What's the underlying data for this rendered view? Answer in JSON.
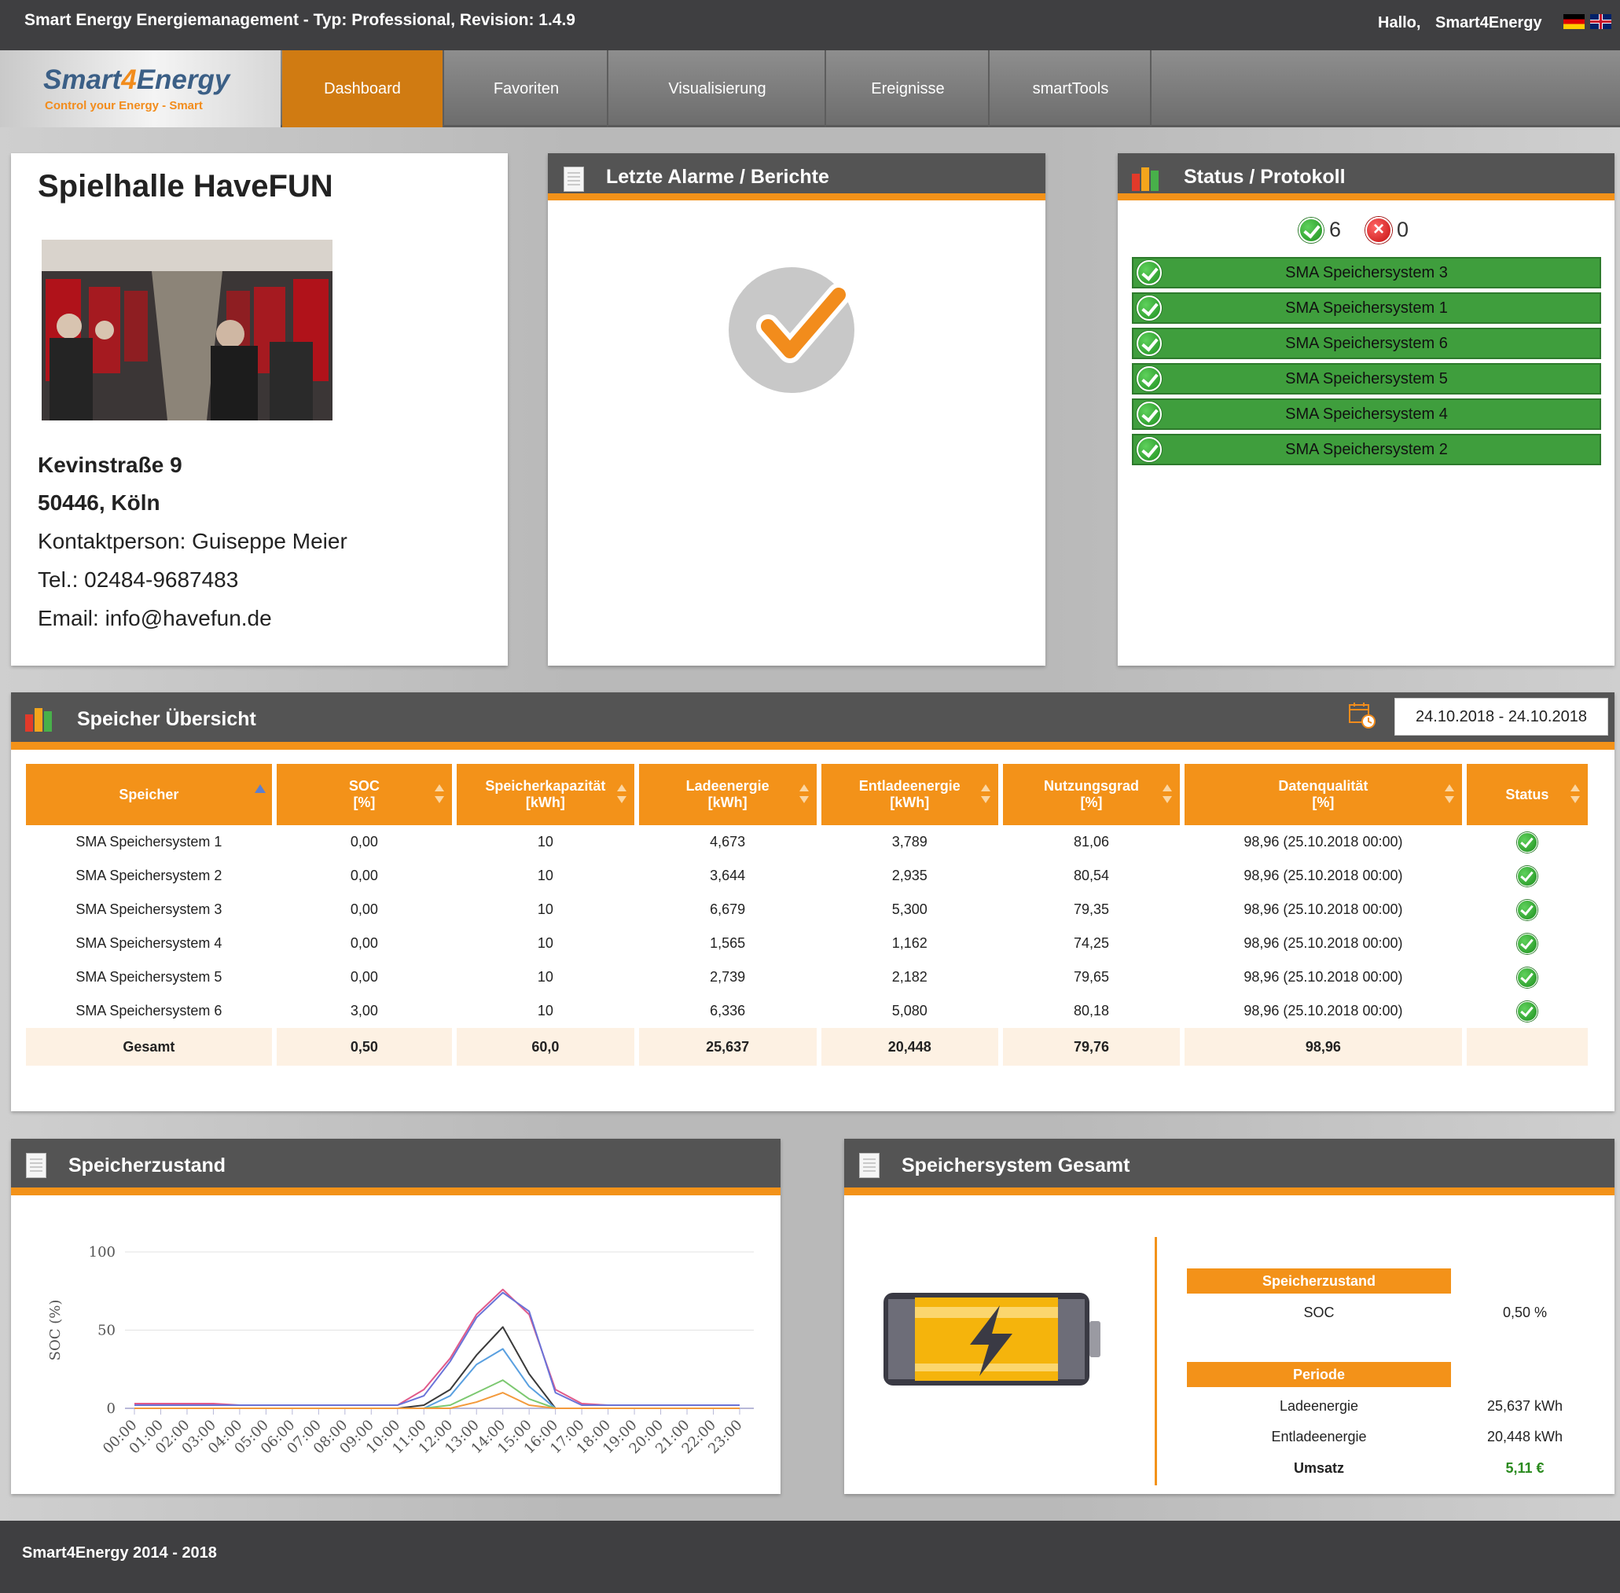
{
  "topbar": {
    "title": "Smart Energy Energiemanagement - Typ: Professional, Revision: 1.4.9",
    "greeting": "Hallo,",
    "user": "Smart4Energy",
    "flags": [
      "de-flag-icon",
      "uk-flag-icon"
    ]
  },
  "logo": {
    "brand_a": "Smart",
    "brand_num": "4",
    "brand_b": "Energy",
    "tagline": "Control your Energy - Smart"
  },
  "nav": {
    "items": [
      {
        "label": "Dashboard",
        "active": true
      },
      {
        "label": "Favoriten",
        "active": false
      },
      {
        "label": "Visualisierung",
        "active": false
      },
      {
        "label": "Ereignisse",
        "active": false
      },
      {
        "label": "smartTools",
        "active": false
      }
    ]
  },
  "site": {
    "name": "Spielhalle HaveFUN",
    "street": "Kevinstraße 9",
    "city": "50446, Köln",
    "contact": "Kontaktperson: Guiseppe Meier",
    "phone": "Tel.: 02484-9687483",
    "email": "Email: info@havefun.de"
  },
  "alarms": {
    "title": "Letzte Alarme / Berichte",
    "icon": "check-badge-icon"
  },
  "status": {
    "title": "Status / Protokoll",
    "ok_count": "6",
    "error_count": "0",
    "rows": [
      "SMA Speichersystem 3",
      "SMA Speichersystem 1",
      "SMA Speichersystem 6",
      "SMA Speichersystem 5",
      "SMA Speichersystem 4",
      "SMA Speichersystem 2"
    ]
  },
  "overview": {
    "title": "Speicher Übersicht",
    "date_range": "24.10.2018 - 24.10.2018",
    "columns": [
      {
        "line1": "Speicher",
        "line2": ""
      },
      {
        "line1": "SOC",
        "line2": "[%]"
      },
      {
        "line1": "Speicherkapazität",
        "line2": "[kWh]"
      },
      {
        "line1": "Ladeenergie",
        "line2": "[kWh]"
      },
      {
        "line1": "Entladeenergie",
        "line2": "[kWh]"
      },
      {
        "line1": "Nutzungsgrad",
        "line2": "[%]"
      },
      {
        "line1": "Datenqualität",
        "line2": "[%]"
      },
      {
        "line1": "Status",
        "line2": ""
      }
    ],
    "rows": [
      [
        "SMA Speichersystem 1",
        "0,00",
        "10",
        "4,673",
        "3,789",
        "81,06",
        "98,96 (25.10.2018 00:00)"
      ],
      [
        "SMA Speichersystem 2",
        "0,00",
        "10",
        "3,644",
        "2,935",
        "80,54",
        "98,96 (25.10.2018 00:00)"
      ],
      [
        "SMA Speichersystem 3",
        "0,00",
        "10",
        "6,679",
        "5,300",
        "79,35",
        "98,96 (25.10.2018 00:00)"
      ],
      [
        "SMA Speichersystem 4",
        "0,00",
        "10",
        "1,565",
        "1,162",
        "74,25",
        "98,96 (25.10.2018 00:00)"
      ],
      [
        "SMA Speichersystem 5",
        "0,00",
        "10",
        "2,739",
        "2,182",
        "79,65",
        "98,96 (25.10.2018 00:00)"
      ],
      [
        "SMA Speichersystem 6",
        "3,00",
        "10",
        "6,336",
        "5,080",
        "80,18",
        "98,96 (25.10.2018 00:00)"
      ]
    ],
    "total": [
      "Gesamt",
      "0,50",
      "60,0",
      "25,637",
      "20,448",
      "79,76",
      "98,96",
      ""
    ]
  },
  "soc_panel": {
    "title": "Speicherzustand"
  },
  "chart_data": {
    "type": "line",
    "ylabel": "SOC (%)",
    "ylim": [
      0,
      100
    ],
    "yticks": [
      "100",
      "50",
      "0"
    ],
    "x": [
      "00:00",
      "01:00",
      "02:00",
      "03:00",
      "04:00",
      "05:00",
      "06:00",
      "07:00",
      "08:00",
      "09:00",
      "10:00",
      "11:00",
      "12:00",
      "13:00",
      "14:00",
      "15:00",
      "16:00",
      "17:00",
      "18:00",
      "19:00",
      "20:00",
      "21:00",
      "22:00",
      "23:00"
    ],
    "grid": true,
    "series": [
      {
        "color": "#e05a8a",
        "values": [
          3,
          3,
          3,
          3,
          2,
          2,
          2,
          2,
          2,
          2,
          2,
          12,
          32,
          60,
          76,
          60,
          12,
          3,
          2,
          2,
          2,
          2,
          2,
          2
        ]
      },
      {
        "color": "#6a73d8",
        "values": [
          2,
          2,
          2,
          2,
          2,
          2,
          2,
          2,
          2,
          2,
          2,
          8,
          30,
          58,
          74,
          62,
          10,
          2,
          2,
          2,
          2,
          2,
          2,
          2
        ]
      },
      {
        "color": "#3a3a3a",
        "values": [
          0,
          0,
          0,
          0,
          0,
          0,
          0,
          0,
          0,
          0,
          0,
          2,
          12,
          34,
          52,
          22,
          0,
          0,
          0,
          0,
          0,
          0,
          0,
          0
        ]
      },
      {
        "color": "#5aa0e0",
        "values": [
          0,
          0,
          0,
          0,
          0,
          0,
          0,
          0,
          0,
          0,
          0,
          0,
          8,
          28,
          38,
          14,
          0,
          0,
          0,
          0,
          0,
          0,
          0,
          0
        ]
      },
      {
        "color": "#7cc870",
        "values": [
          0,
          0,
          0,
          0,
          0,
          0,
          0,
          0,
          0,
          0,
          0,
          0,
          2,
          10,
          18,
          6,
          0,
          0,
          0,
          0,
          0,
          0,
          0,
          0
        ]
      },
      {
        "color": "#f39a3c",
        "values": [
          0,
          0,
          0,
          0,
          0,
          0,
          0,
          0,
          0,
          0,
          0,
          0,
          0,
          4,
          10,
          2,
          0,
          0,
          0,
          0,
          0,
          0,
          0,
          0
        ]
      }
    ]
  },
  "total_panel": {
    "title": "Speichersystem Gesamt",
    "icon": "battery-icon",
    "state_header": "Speicherzustand",
    "soc_label": "SOC",
    "soc_value": "0,50 %",
    "period_header": "Periode",
    "charge_label": "Ladeenergie",
    "charge_value": "25,637 kWh",
    "discharge_label": "Entladeenergie",
    "discharge_value": "20,448 kWh",
    "revenue_label": "Umsatz",
    "revenue_value": "5,11 €"
  },
  "footer": {
    "text": "Smart4Energy 2014 - 2018"
  },
  "colors": {
    "accent": "#f39219",
    "dark": "#3f3f41",
    "ok_green": "#3f9e3d",
    "revenue": "#2a8a1e"
  }
}
